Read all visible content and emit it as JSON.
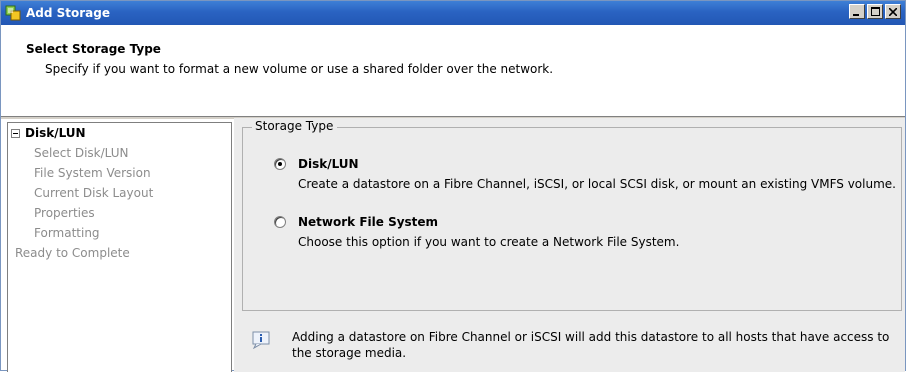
{
  "window": {
    "title": "Add Storage",
    "controls": [
      "minimize",
      "maximize",
      "close"
    ]
  },
  "header": {
    "title": "Select Storage Type",
    "subtitle": "Specify if you want to format a new volume or use a shared folder over the network."
  },
  "nav": {
    "top": "Disk/LUN",
    "steps": [
      "Select Disk/LUN",
      "File System Version",
      "Current Disk Layout",
      "Properties",
      "Formatting"
    ],
    "ready": "Ready to Complete"
  },
  "storage_type": {
    "legend": "Storage Type",
    "options": [
      {
        "label": "Disk/LUN",
        "description": "Create a datastore on a Fibre Channel, iSCSI, or local SCSI disk, or mount an existing VMFS volume.",
        "selected": true
      },
      {
        "label": "Network File System",
        "description": "Choose this option if you want to create a Network File System.",
        "selected": false
      }
    ]
  },
  "info": {
    "text": "Adding a datastore on Fibre Channel or iSCSI will add this datastore to all hosts that have access to the storage media."
  },
  "colors": {
    "titlebar": "#2a63c2",
    "panel_bg": "#ececec",
    "disabled_text": "#8c8c8c"
  }
}
